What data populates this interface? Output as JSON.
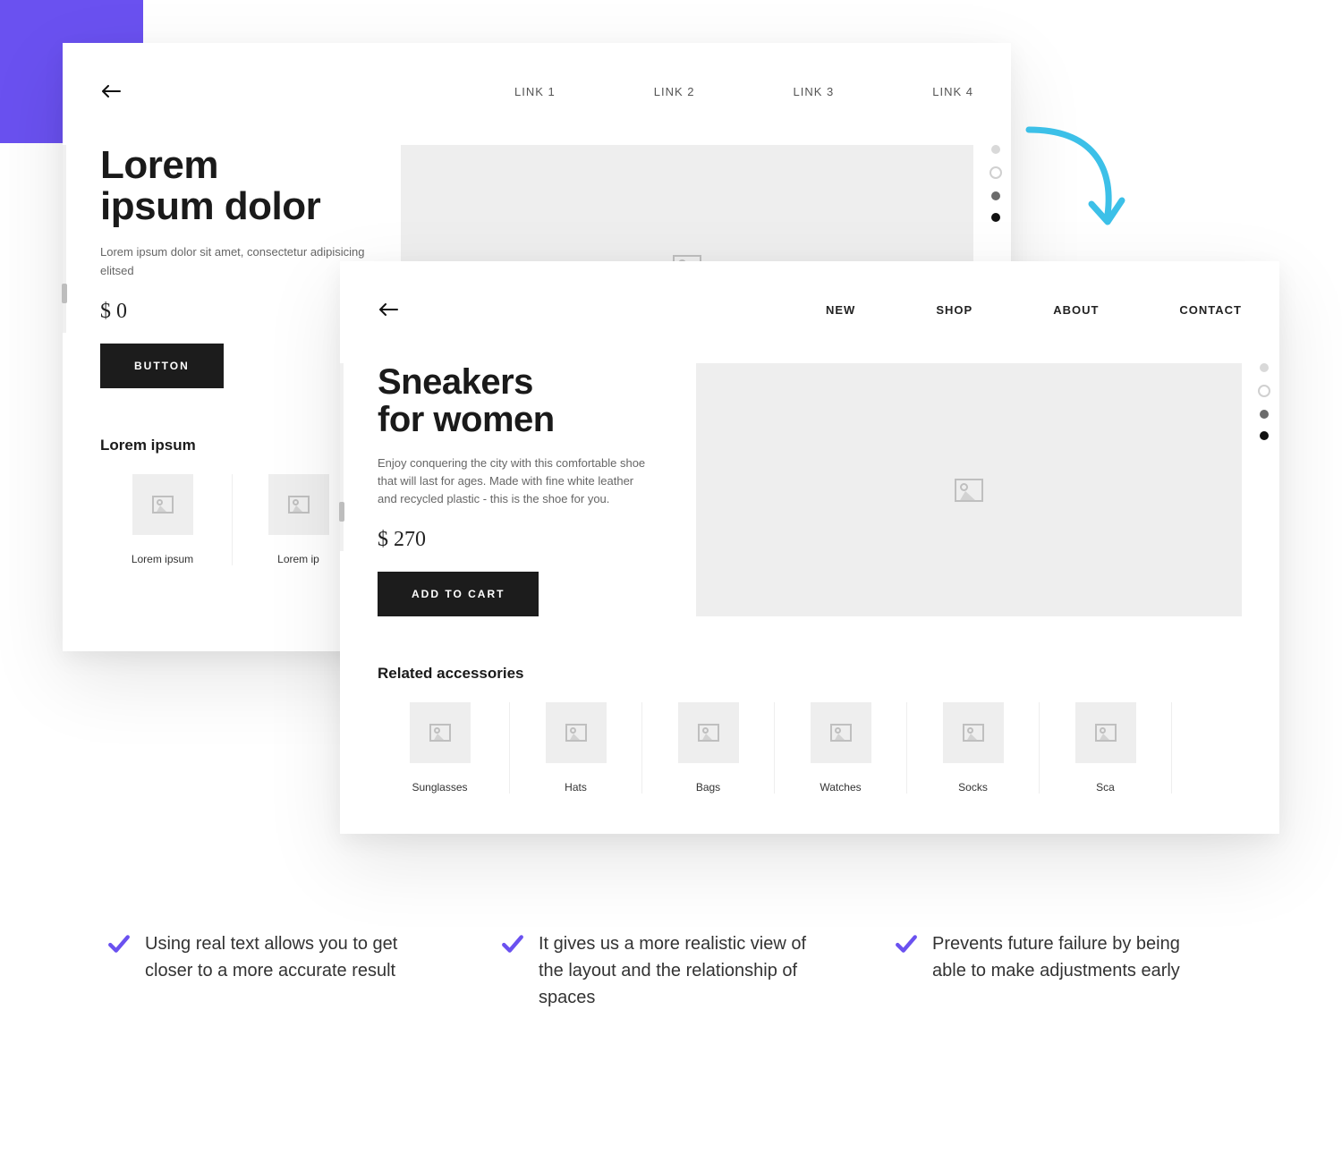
{
  "wireframe": {
    "nav": [
      "LINK 1",
      "LINK 2",
      "LINK 3",
      "LINK 4"
    ],
    "title_line1": "Lorem",
    "title_line2": "ipsum dolor",
    "desc": "Lorem ipsum dolor sit amet, consectetur adipisicing elitsed",
    "price": "$ 0",
    "button": "BUTTON",
    "related_title": "Lorem ipsum",
    "related_items": [
      "Lorem ipsum",
      "Lorem ip"
    ]
  },
  "mockup": {
    "nav": [
      "NEW",
      "SHOP",
      "ABOUT",
      "CONTACT"
    ],
    "title_line1": "Sneakers",
    "title_line2": "for women",
    "desc": "Enjoy conquering the city with this comfortable shoe that will last for ages. Made with fine white leather and recycled plastic - this is the shoe for you.",
    "price": "$ 270",
    "button": "ADD TO CART",
    "related_title": "Related accessories",
    "related_items": [
      "Sunglasses",
      "Hats",
      "Bags",
      "Watches",
      "Socks",
      "Sca"
    ]
  },
  "benefits": [
    "Using real text allows you to get closer to a more accurate result",
    "It gives us a more realistic view of the layout and the relationship of spaces",
    "Prevents future failure by being able to make adjustments early"
  ],
  "colors": {
    "accent": "#6a51f0",
    "arrow": "#3cc0e8"
  }
}
